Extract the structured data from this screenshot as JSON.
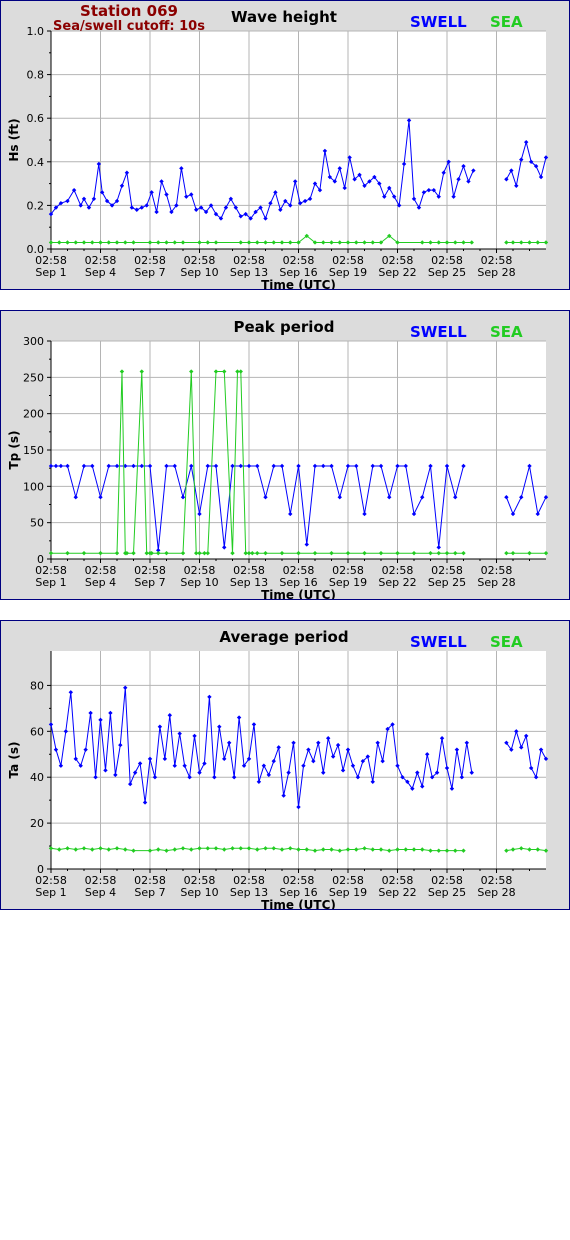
{
  "station": {
    "title": "Station 069",
    "subtitle": "Sea/swell cutoff: 10s",
    "color": "#8b0000"
  },
  "colors": {
    "swell": "#0000ff",
    "sea": "#22cc22",
    "grid": "#b4b4b4",
    "panel_bg": "#dcdcdc",
    "border": "#000080"
  },
  "legend": {
    "swell": "SWELL",
    "sea": "SEA"
  },
  "x_ticks": [
    {
      "time": "02:58",
      "date": "Sep 1"
    },
    {
      "time": "02:58",
      "date": "Sep 4"
    },
    {
      "time": "02:58",
      "date": "Sep 7"
    },
    {
      "time": "02:58",
      "date": "Sep 10"
    },
    {
      "time": "02:58",
      "date": "Sep 13"
    },
    {
      "time": "02:58",
      "date": "Sep 16"
    },
    {
      "time": "02:58",
      "date": "Sep 19"
    },
    {
      "time": "02:58",
      "date": "Sep 22"
    },
    {
      "time": "02:58",
      "date": "Sep 25"
    },
    {
      "time": "02:58",
      "date": "Sep 28"
    }
  ],
  "chart_data": [
    {
      "type": "line",
      "title": "Wave height",
      "xlabel": "Time (UTC)",
      "ylabel": "Hs (ft)",
      "xlim": [
        0,
        30
      ],
      "ylim": [
        0,
        1.0
      ],
      "y_ticks": [
        "0.0",
        "0.2",
        "0.4",
        "0.6",
        "0.8",
        "1.0"
      ],
      "y_tick_values": [
        0,
        0.2,
        0.4,
        0.6,
        0.8,
        1.0
      ],
      "gaps": [
        [
          26.1,
          27.6
        ]
      ],
      "series": [
        {
          "name": "SWELL",
          "x": [
            0,
            0.3,
            0.6,
            1,
            1.4,
            1.8,
            2,
            2.3,
            2.6,
            2.9,
            3.1,
            3.4,
            3.7,
            4,
            4.3,
            4.6,
            4.9,
            5.2,
            5.5,
            5.8,
            6.1,
            6.4,
            6.7,
            7,
            7.3,
            7.6,
            7.9,
            8.2,
            8.5,
            8.8,
            9.1,
            9.4,
            9.7,
            10,
            10.3,
            10.6,
            10.9,
            11.2,
            11.5,
            11.8,
            12.1,
            12.4,
            12.7,
            13,
            13.3,
            13.6,
            13.9,
            14.2,
            14.5,
            14.8,
            15.1,
            15.4,
            15.7,
            16,
            16.3,
            16.6,
            16.9,
            17.2,
            17.5,
            17.8,
            18.1,
            18.4,
            18.7,
            19,
            19.3,
            19.6,
            19.9,
            20.2,
            20.5,
            20.8,
            21.1,
            21.4,
            21.7,
            22,
            22.3,
            22.6,
            22.9,
            23.2,
            23.5,
            23.8,
            24.1,
            24.4,
            24.7,
            25,
            25.3,
            25.6,
            27.6,
            27.9,
            28.2,
            28.5,
            28.8,
            29.1,
            29.4,
            29.7,
            30
          ],
          "values": [
            0.16,
            0.19,
            0.21,
            0.22,
            0.27,
            0.2,
            0.23,
            0.19,
            0.23,
            0.39,
            0.26,
            0.22,
            0.2,
            0.22,
            0.29,
            0.35,
            0.19,
            0.18,
            0.19,
            0.2,
            0.26,
            0.17,
            0.31,
            0.25,
            0.17,
            0.2,
            0.37,
            0.24,
            0.25,
            0.18,
            0.19,
            0.17,
            0.2,
            0.16,
            0.14,
            0.19,
            0.23,
            0.19,
            0.15,
            0.16,
            0.14,
            0.17,
            0.19,
            0.14,
            0.21,
            0.26,
            0.18,
            0.22,
            0.2,
            0.31,
            0.21,
            0.22,
            0.23,
            0.3,
            0.27,
            0.45,
            0.33,
            0.31,
            0.37,
            0.28,
            0.42,
            0.32,
            0.34,
            0.29,
            0.31,
            0.33,
            0.3,
            0.24,
            0.28,
            0.24,
            0.2,
            0.39,
            0.59,
            0.23,
            0.19,
            0.26,
            0.27,
            0.27,
            0.24,
            0.35,
            0.4,
            0.24,
            0.32,
            0.38,
            0.31,
            0.36,
            0.32,
            0.36,
            0.29,
            0.41,
            0.49,
            0.4,
            0.38,
            0.33,
            0.42
          ]
        },
        {
          "name": "SEA",
          "x": [
            0,
            0.5,
            1,
            1.5,
            2,
            2.5,
            3,
            3.5,
            4,
            4.5,
            5,
            6,
            6.5,
            7,
            7.5,
            8,
            9,
            9.5,
            10,
            11.5,
            12,
            12.5,
            13,
            13.5,
            14,
            14.5,
            15,
            15.5,
            16,
            16.5,
            17,
            17.5,
            18,
            18.5,
            19,
            19.5,
            20,
            20.5,
            21,
            22.5,
            23,
            23.5,
            24,
            24.5,
            25,
            25.5,
            27.6,
            28,
            28.5,
            29,
            29.5,
            30
          ],
          "values": [
            0.03,
            0.03,
            0.03,
            0.03,
            0.03,
            0.03,
            0.03,
            0.03,
            0.03,
            0.03,
            0.03,
            0.03,
            0.03,
            0.03,
            0.03,
            0.03,
            0.03,
            0.03,
            0.03,
            0.03,
            0.03,
            0.03,
            0.03,
            0.03,
            0.03,
            0.03,
            0.03,
            0.06,
            0.03,
            0.03,
            0.03,
            0.03,
            0.03,
            0.03,
            0.03,
            0.03,
            0.03,
            0.06,
            0.03,
            0.03,
            0.03,
            0.03,
            0.03,
            0.03,
            0.03,
            0.03,
            0.03,
            0.03,
            0.03,
            0.03,
            0.03,
            0.03
          ]
        }
      ]
    },
    {
      "type": "line",
      "title": "Peak period",
      "xlabel": "Time (UTC)",
      "ylabel": "Tp (s)",
      "xlim": [
        0,
        30
      ],
      "ylim": [
        0,
        300
      ],
      "y_ticks": [
        "0",
        "50",
        "100",
        "150",
        "200",
        "250",
        "300"
      ],
      "y_tick_values": [
        0,
        50,
        100,
        150,
        200,
        250,
        300
      ],
      "gaps": [
        [
          25.5,
          27.6
        ]
      ],
      "series": [
        {
          "name": "SWELL",
          "x": [
            0,
            0.3,
            0.6,
            1,
            1.5,
            2,
            2.5,
            3,
            3.5,
            4,
            4.5,
            5,
            5.5,
            6,
            6.5,
            7,
            7.5,
            8,
            8.5,
            9,
            9.5,
            10,
            10.5,
            11,
            11.5,
            12,
            12.5,
            13,
            13.5,
            14,
            14.5,
            15,
            15.5,
            16,
            16.5,
            17,
            17.5,
            18,
            18.5,
            19,
            19.5,
            20,
            20.5,
            21,
            21.5,
            22,
            22.5,
            23,
            23.5,
            24,
            24.5,
            25,
            27.6,
            28,
            28.5,
            29,
            29.5,
            30
          ],
          "values": [
            128,
            128,
            128,
            128,
            85,
            128,
            128,
            85,
            128,
            128,
            128,
            128,
            128,
            128,
            12,
            128,
            128,
            85,
            128,
            62,
            128,
            128,
            16,
            128,
            128,
            128,
            128,
            85,
            128,
            128,
            62,
            128,
            20,
            128,
            128,
            128,
            85,
            128,
            128,
            62,
            128,
            128,
            85,
            128,
            128,
            62,
            85,
            128,
            16,
            128,
            85,
            128,
            85,
            62,
            85,
            128,
            62,
            85
          ]
        },
        {
          "name": "SEA",
          "x": [
            0,
            1,
            2,
            3,
            4,
            4.3,
            4.5,
            4.6,
            5,
            5.5,
            5.8,
            6,
            6.1,
            6.5,
            7,
            8,
            8.5,
            8.8,
            9,
            9.3,
            9.5,
            10,
            10.5,
            11,
            11.3,
            11.5,
            11.8,
            12,
            12.2,
            12.5,
            13,
            14,
            15,
            16,
            17,
            18,
            19,
            20,
            21,
            22,
            23,
            23.5,
            24,
            24.5,
            25,
            27.6,
            28,
            29,
            30
          ],
          "values": [
            8,
            8,
            8,
            8,
            8,
            258,
            8,
            8,
            8,
            258,
            8,
            8,
            8,
            8,
            8,
            8,
            258,
            8,
            8,
            8,
            8,
            258,
            258,
            8,
            258,
            258,
            8,
            8,
            8,
            8,
            8,
            8,
            8,
            8,
            8,
            8,
            8,
            8,
            8,
            8,
            8,
            8,
            8,
            8,
            8,
            8,
            8,
            8,
            8
          ]
        }
      ]
    },
    {
      "type": "line",
      "title": "Average period",
      "xlabel": "Time (UTC)",
      "ylabel": "Ta (s)",
      "xlim": [
        0,
        30
      ],
      "ylim": [
        0,
        95
      ],
      "y_ticks": [
        "0",
        "20",
        "40",
        "60",
        "80"
      ],
      "y_tick_values": [
        0,
        20,
        40,
        60,
        80
      ],
      "gaps": [
        [
          25.5,
          27.6
        ]
      ],
      "series": [
        {
          "name": "SWELL",
          "x": [
            0,
            0.3,
            0.6,
            0.9,
            1.2,
            1.5,
            1.8,
            2.1,
            2.4,
            2.7,
            3,
            3.3,
            3.6,
            3.9,
            4.2,
            4.5,
            4.8,
            5.1,
            5.4,
            5.7,
            6,
            6.3,
            6.6,
            6.9,
            7.2,
            7.5,
            7.8,
            8.1,
            8.4,
            8.7,
            9,
            9.3,
            9.6,
            9.9,
            10.2,
            10.5,
            10.8,
            11.1,
            11.4,
            11.7,
            12,
            12.3,
            12.6,
            12.9,
            13.2,
            13.5,
            13.8,
            14.1,
            14.4,
            14.7,
            15,
            15.3,
            15.6,
            15.9,
            16.2,
            16.5,
            16.8,
            17.1,
            17.4,
            17.7,
            18,
            18.3,
            18.6,
            18.9,
            19.2,
            19.5,
            19.8,
            20.1,
            20.4,
            20.7,
            21,
            21.3,
            21.6,
            21.9,
            22.2,
            22.5,
            22.8,
            23.1,
            23.4,
            23.7,
            24,
            24.3,
            24.6,
            24.9,
            25.2,
            25.5,
            27.6,
            27.9,
            28.2,
            28.5,
            28.8,
            29.1,
            29.4,
            29.7,
            30
          ],
          "values": [
            63,
            52,
            45,
            60,
            77,
            48,
            45,
            52,
            68,
            40,
            65,
            43,
            68,
            41,
            54,
            79,
            37,
            42,
            46,
            29,
            48,
            40,
            62,
            48,
            67,
            45,
            59,
            45,
            40,
            58,
            42,
            46,
            75,
            40,
            62,
            48,
            55,
            40,
            66,
            45,
            48,
            63,
            38,
            45,
            41,
            47,
            53,
            32,
            42,
            55,
            27,
            45,
            52,
            47,
            55,
            42,
            57,
            49,
            54,
            43,
            52,
            45,
            40,
            47,
            49,
            38,
            55,
            47,
            61,
            63,
            45,
            40,
            38,
            35,
            42,
            36,
            50,
            40,
            42,
            57,
            44,
            35,
            52,
            40,
            55,
            42,
            55,
            52,
            60,
            53,
            58,
            44,
            40,
            52,
            48
          ]
        },
        {
          "name": "SEA",
          "x": [
            0,
            0.5,
            1,
            1.5,
            2,
            2.5,
            3,
            3.5,
            4,
            4.5,
            5,
            6,
            6.5,
            7,
            7.5,
            8,
            8.5,
            9,
            9.5,
            10,
            10.5,
            11,
            11.5,
            12,
            12.5,
            13,
            13.5,
            14,
            14.5,
            15,
            15.5,
            16,
            16.5,
            17,
            17.5,
            18,
            18.5,
            19,
            19.5,
            20,
            20.5,
            21,
            21.5,
            22,
            22.5,
            23,
            23.5,
            24,
            24.5,
            25,
            27.6,
            28,
            28.5,
            29,
            29.5,
            30
          ],
          "values": [
            9,
            8.5,
            9,
            8.5,
            9,
            8.5,
            9,
            8.5,
            9,
            8.5,
            8,
            8,
            8.5,
            8,
            8.5,
            9,
            8.5,
            9,
            9,
            9,
            8.5,
            9,
            9,
            9,
            8.5,
            9,
            9,
            8.5,
            9,
            8.5,
            8.5,
            8,
            8.5,
            8.5,
            8,
            8.5,
            8.5,
            9,
            8.5,
            8.5,
            8,
            8.5,
            8.5,
            8.5,
            8.5,
            8,
            8,
            8,
            8,
            8,
            8,
            8.5,
            9,
            8.5,
            8.5,
            8
          ]
        }
      ]
    }
  ]
}
